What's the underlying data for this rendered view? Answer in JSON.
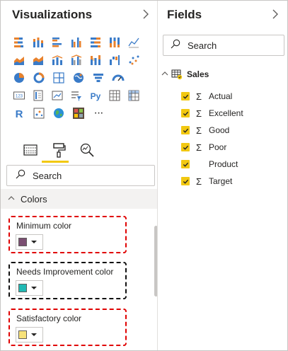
{
  "visualizations": {
    "title": "Visualizations",
    "collapse_icon": "chevron-right-icon",
    "icons": [
      [
        "stacked-bar-icon",
        "stacked-column-icon",
        "clustered-bar-icon",
        "clustered-column-icon",
        "100-stacked-bar-icon",
        "100-stacked-column-icon",
        "line-chart-icon"
      ],
      [
        "area-chart-icon",
        "stacked-area-icon",
        "line-column-icon",
        "line-clustered-column-icon",
        "ribbon-chart-icon",
        "waterfall-icon",
        "scatter-icon"
      ],
      [
        "pie-chart-icon",
        "donut-chart-icon",
        "treemap-icon",
        "map-icon",
        "funnel-icon",
        "gauge-icon"
      ],
      [
        "card-icon",
        "multi-row-card-icon",
        "kpi-icon",
        "slicer-icon",
        "python-visual-icon",
        "table-icon",
        "matrix-icon"
      ],
      [
        "r-visual-icon",
        "key-influencers-icon",
        "globe-map-icon",
        "custom-visual-icon",
        "more-icon"
      ]
    ],
    "r_label": "R",
    "py_label": "Py",
    "card_label": "123",
    "more_label": "···",
    "tabs": [
      "fields-tab-icon",
      "format-paint-roller-icon",
      "analytics-magnifier-icon"
    ],
    "search_placeholder": "Search",
    "section": "Colors",
    "color_groups": [
      {
        "label": "Minimum color",
        "color": "#7b4f72",
        "border": "red"
      },
      {
        "label": "Needs Improvement color",
        "color": "#21b9b4",
        "border": "black"
      },
      {
        "label": "Satisfactory color",
        "color": "#f7e27a",
        "border": "red"
      }
    ]
  },
  "fields": {
    "title": "Fields",
    "collapse_icon": "chevron-right-icon",
    "search_placeholder": "Search",
    "table_name": "Sales",
    "items": [
      {
        "label": "Actual",
        "sigma": "Σ"
      },
      {
        "label": "Excellent",
        "sigma": "Σ"
      },
      {
        "label": "Good",
        "sigma": "Σ"
      },
      {
        "label": "Poor",
        "sigma": "Σ"
      },
      {
        "label": "Product",
        "sigma": ""
      },
      {
        "label": "Target",
        "sigma": "Σ"
      }
    ]
  },
  "colors": {
    "accent": "#f2c811",
    "highlight_red": "#e00000",
    "highlight_black": "#111111"
  }
}
